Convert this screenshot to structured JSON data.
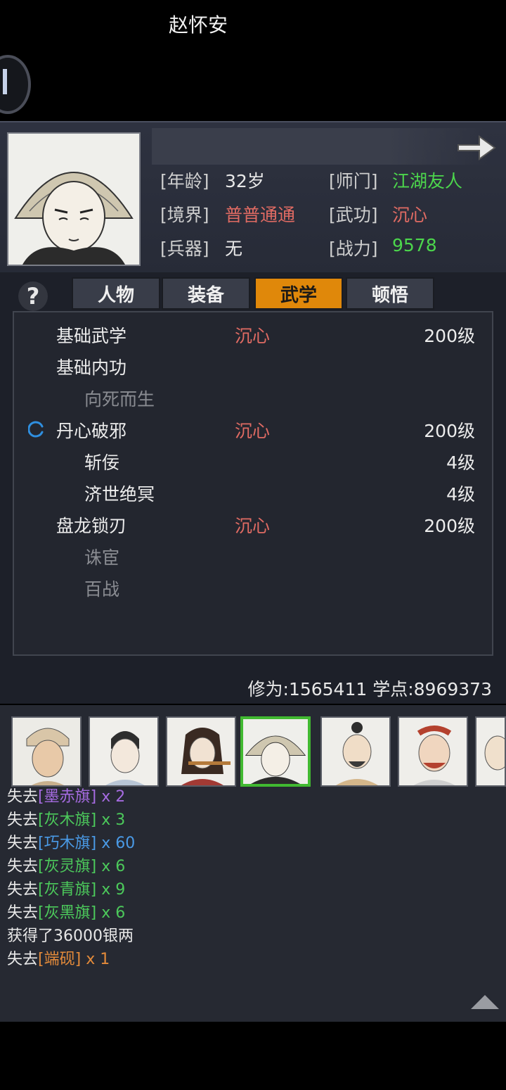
{
  "profile": {
    "name": "赵怀安",
    "attributes": {
      "age_label": "[年龄]",
      "age": "32岁",
      "sect_label": "[师门]",
      "sect": "江湖友人",
      "realm_label": "[境界]",
      "realm": "普普通通",
      "martial_label": "[武功]",
      "martial": "沉心",
      "weapon_label": "[兵器]",
      "weapon": "无",
      "power_label": "[战力]",
      "power": "9578"
    }
  },
  "tabs": [
    {
      "label": "人物",
      "active": false
    },
    {
      "label": "装备",
      "active": false
    },
    {
      "label": "武学",
      "active": true
    },
    {
      "label": "顿悟",
      "active": false
    }
  ],
  "help_glyph": "?",
  "skills": [
    {
      "name": "基础武学",
      "style": "沉心",
      "level": "200级",
      "indent": false,
      "dim": false
    },
    {
      "name": "基础内功",
      "style": "",
      "level": "",
      "indent": false,
      "dim": false
    },
    {
      "name": "向死而生",
      "style": "",
      "level": "",
      "indent": true,
      "dim": true
    },
    {
      "name": "丹心破邪",
      "style": "沉心",
      "level": "200级",
      "indent": false,
      "dim": false
    },
    {
      "name": "斩佞",
      "style": "",
      "level": "4级",
      "indent": true,
      "dim": false
    },
    {
      "name": "济世绝冥",
      "style": "",
      "level": "4级",
      "indent": true,
      "dim": false
    },
    {
      "name": "盘龙锁刃",
      "style": "沉心",
      "level": "200级",
      "indent": false,
      "dim": false
    },
    {
      "name": "诛宦",
      "style": "",
      "level": "",
      "indent": true,
      "dim": true
    },
    {
      "name": "百战",
      "style": "",
      "level": "",
      "indent": true,
      "dim": true
    }
  ],
  "stats": {
    "text": "修为:1565411 学点:8969373"
  },
  "party_selected_index": 3,
  "log": [
    {
      "prefix": "失去",
      "item": "[墨赤旗]",
      "qty": "x 2",
      "color": "#a56be0"
    },
    {
      "prefix": "失去",
      "item": "[灰木旗]",
      "qty": "x 3",
      "color": "#4cc95b"
    },
    {
      "prefix": "失去",
      "item": "[巧木旗]",
      "qty": "x 60",
      "color": "#4a9ae6"
    },
    {
      "prefix": "失去",
      "item": "[灰灵旗]",
      "qty": "x 6",
      "color": "#4cc95b"
    },
    {
      "prefix": "失去",
      "item": "[灰青旗]",
      "qty": "x 9",
      "color": "#4cc95b"
    },
    {
      "prefix": "失去",
      "item": "[灰黑旗]",
      "qty": "x 6",
      "color": "#4cc95b"
    },
    {
      "prefix": "获得了36000银两",
      "item": "",
      "qty": "",
      "color": "#e8e8e8"
    },
    {
      "prefix": "失去",
      "item": "[端砚]",
      "qty": "x 1",
      "color": "#e38a3a"
    }
  ],
  "colors": {
    "green": "#4cd64c",
    "red": "#e06b63",
    "active_tab": "#e0880a",
    "dim_text": "#8a8c92"
  }
}
